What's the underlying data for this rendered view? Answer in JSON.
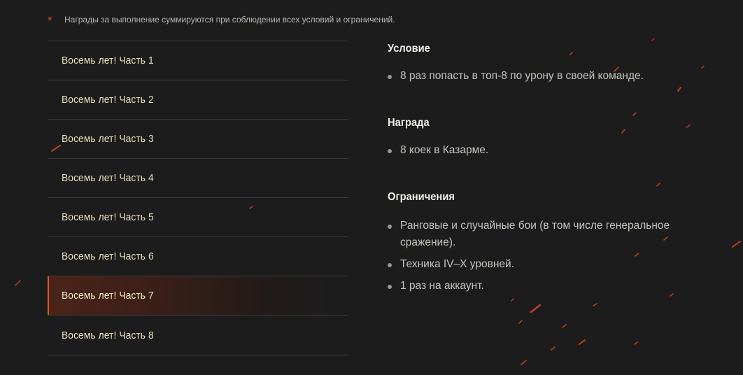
{
  "note": {
    "marker": "*",
    "text": "Награды за выполнение суммируются при соблюдении всех условий и ограничений."
  },
  "tabs": [
    {
      "label": "Восемь лет! Часть 1",
      "active": false
    },
    {
      "label": "Восемь лет! Часть 2",
      "active": false
    },
    {
      "label": "Восемь лет! Часть 3",
      "active": false
    },
    {
      "label": "Восемь лет! Часть 4",
      "active": false
    },
    {
      "label": "Восемь лет! Часть 5",
      "active": false
    },
    {
      "label": "Восемь лет! Часть 6",
      "active": false
    },
    {
      "label": "Восемь лет! Часть 7",
      "active": true
    },
    {
      "label": "Восемь лет! Часть 8",
      "active": false
    }
  ],
  "details": {
    "condition": {
      "title": "Условие",
      "items": [
        "8 раз попасть в топ-8 по урону в своей команде."
      ]
    },
    "reward": {
      "title": "Награда",
      "items": [
        "8 коек в Казарме."
      ]
    },
    "restrictions": {
      "title": "Ограничения",
      "items": [
        "Ранговые и случайные бои (в том числе генеральное сражение).",
        "Техника IV–X уровней.",
        "1 раз на аккаунт."
      ]
    }
  },
  "colors": {
    "background": "#1c1c1d",
    "accent": "#e5522b",
    "tab_text": "#e9dfb8",
    "heading": "#f1eee6",
    "body_text": "#c6c3bc"
  }
}
